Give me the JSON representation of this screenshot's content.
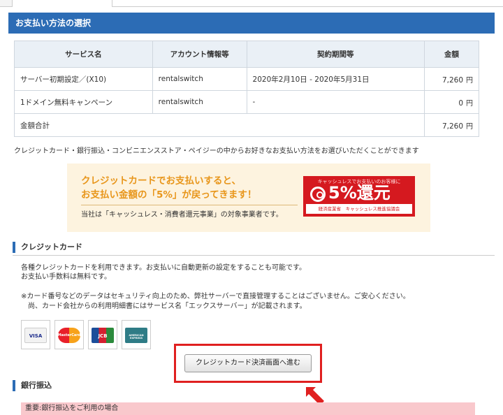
{
  "section_title": "お支払い方法の選択",
  "table": {
    "headers": [
      "サービス名",
      "アカウント情報等",
      "契約期間等",
      "金額"
    ],
    "rows": [
      {
        "service": "サーバー初期設定／(X10)",
        "account": "rentalswitch",
        "period": "2020年2月10日 - 2020年5月31日",
        "amount": "7,260",
        "unit": "円"
      },
      {
        "service": "1ドメイン無料キャンペーン",
        "account": "rentalswitch",
        "period": "-",
        "amount": "0",
        "unit": "円"
      }
    ],
    "total_label": "金額合計",
    "total_amount": "7,260",
    "total_unit": "円"
  },
  "intro_text": "クレジットカード・銀行振込・コンビニエンスストア・ペイジーの中からお好きなお支払い方法をお選びいただくことができます",
  "promo": {
    "headline1": "クレジットカードでお支払いすると、",
    "headline2": "お支払い金額の「5%」が戻ってきます！",
    "subtext": "当社は「キャッシュレス・消費者還元事業」の対象事業者です。",
    "badge_top": "キャッシュレスでお支払いのお客様に",
    "badge_main": "5%還元",
    "badge_bottom": "経済産業省　キャッシュレス推進協議会"
  },
  "credit": {
    "heading": "クレジットカード",
    "line1": "各種クレジットカードを利用できます。お支払いに自動更新の設定をすることも可能です。",
    "line2": "お支払い手数料は無料です。",
    "note1": "※カード番号などのデータはセキュリティ向上のため、弊社サーバーで直接管理することはございません。ご安心ください。",
    "note2": "　尚、カード会社からの利用明細書にはサービス名「エックスサーバー」が記載されます。",
    "cards": [
      "VISA",
      "MasterCard",
      "JCB",
      "AMERICAN EXPRESS"
    ],
    "button": "クレジットカード決済画面へ進む"
  },
  "bank": {
    "heading": "銀行振込",
    "notice": "重要:銀行振込をご利用の場合"
  },
  "colors": {
    "header_blue": "#2c6cb5",
    "promo_orange": "#e8961b",
    "badge_red": "#d5191f",
    "highlight_red": "#e02020",
    "notice_pink": "#f9c8cc"
  }
}
